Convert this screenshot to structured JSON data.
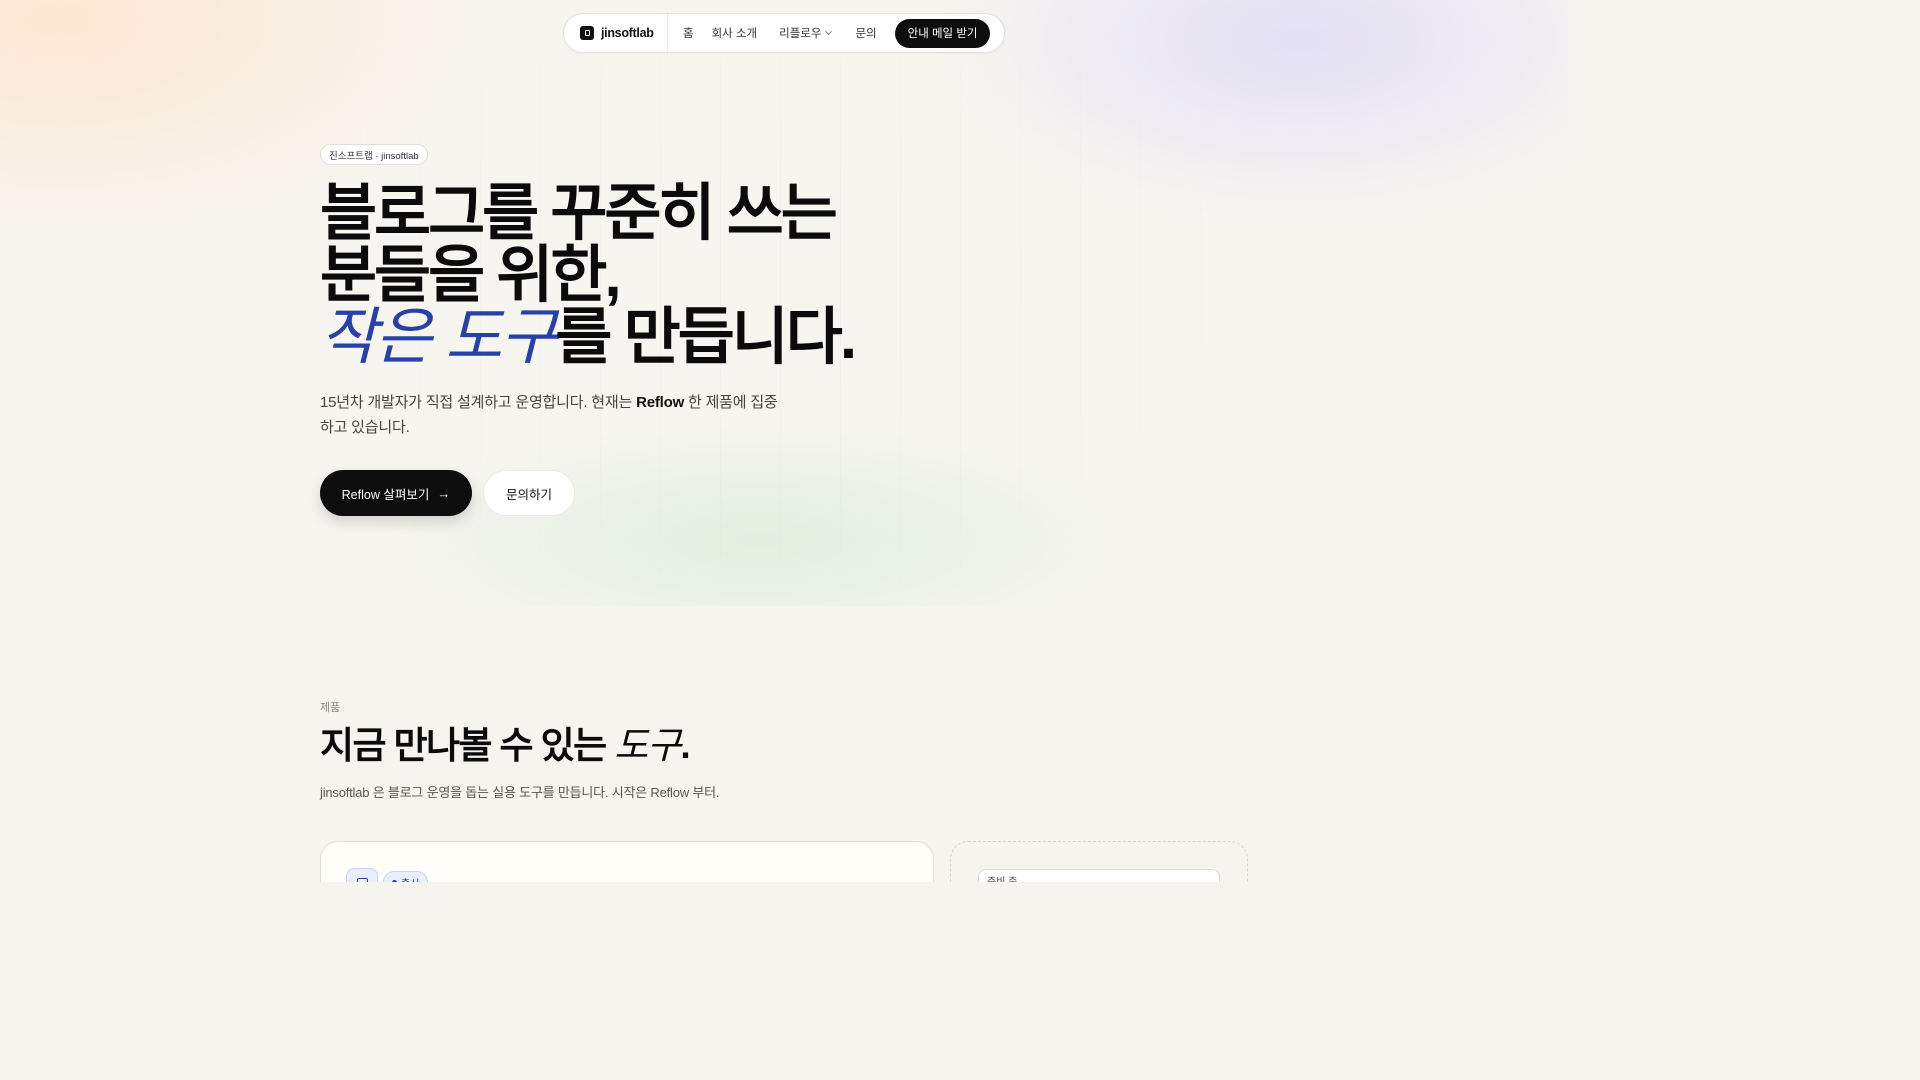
{
  "nav": {
    "brand": "jinsoftlab",
    "brand_icon": "brand-logo-icon",
    "items": [
      {
        "label": "홈"
      },
      {
        "label": "회사 소개"
      },
      {
        "label": "리플로우"
      },
      {
        "label": "문의"
      }
    ],
    "cta_label": "안내 메일 받기"
  },
  "hero": {
    "badge": "진소프트랩 · jinsoftlab",
    "title_line1": "블로그를 꾸준히 쓰는",
    "title_line2": "분들을 위한,",
    "title_line3_emphasis": "작은 도구",
    "title_line3_rest": "를 만듭니다.",
    "subtitle_pre": "15년차 개발자가 직접 설계하고 운영합니다. 현재는 ",
    "subtitle_bold": "Reflow",
    "subtitle_post": " 한 제품에 집중하고 있습니다.",
    "primary_button": "Reflow 살펴보기",
    "primary_button_icon": "arrow-right-icon",
    "secondary_button": "문의하기"
  },
  "products": {
    "label": "제품",
    "title_main": "지금 만나볼 수 있는 ",
    "title_emphasis": "도구",
    "title_end": ".",
    "subtitle": "jinsoftlab 은 블로그 운영을 돕는 실용 도구를 만듭니다. 시작은 Reflow 부터.",
    "card_tag": "출시",
    "card_icon": "document-icon",
    "soon_label": "준비 중"
  },
  "colors": {
    "accent": "#2741a8",
    "dark": "#0d0d0d",
    "background": "#f6f4ef"
  }
}
